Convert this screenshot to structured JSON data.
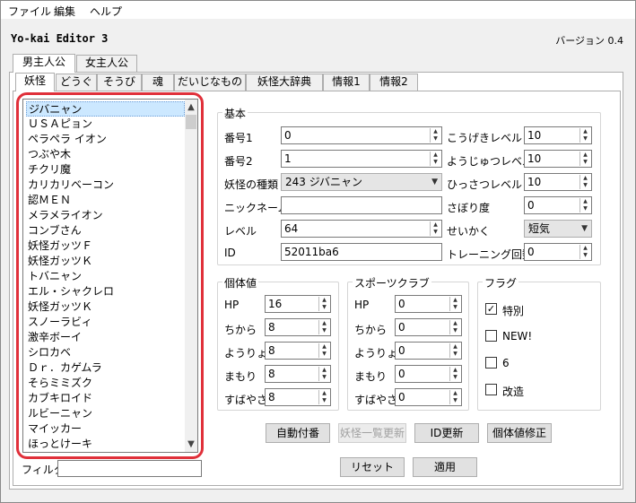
{
  "menubar": {
    "items": [
      "ファイル",
      "編集",
      "ヘルプ"
    ]
  },
  "app": {
    "title": "Yo-kai Editor 3",
    "version": "バージョン 0.4"
  },
  "player_tabs": [
    "男主人公",
    "女主人公"
  ],
  "main_tabs": [
    "妖怪",
    "どうぐ",
    "そうび",
    "魂",
    "だいじなもの",
    "妖怪大辞典",
    "情報1",
    "情報2"
  ],
  "yokai_list": {
    "items": [
      "ジバニャン",
      "ＵＳＡピョン",
      "ペラペラ イオン",
      "つぶや木",
      "チクリ魔",
      "カリカリベーコン",
      "認ＭＥＮ",
      "メラメライオン",
      "コンブさん",
      "妖怪ガッツＦ",
      "妖怪ガッツＫ",
      "トバニャン",
      "エル・シャクレロ",
      "妖怪ガッツＫ",
      "スノーラビィ",
      "激辛ボーイ",
      "シロカベ",
      "Ｄｒ．カゲムラ",
      "そらミミズク",
      "カブキロイド",
      "ルビーニャン",
      "マイッカー",
      "ほっとけーキ"
    ],
    "selected_index": 0
  },
  "filter": {
    "label": "フィルタ",
    "value": ""
  },
  "basic": {
    "title": "基本",
    "no1_label": "番号1",
    "no1_value": "0",
    "no2_label": "番号2",
    "no2_value": "1",
    "kind_label": "妖怪の種類",
    "kind_value": "243 ジバニャン",
    "nickname_label": "ニックネーム",
    "nickname_value": "",
    "level_label": "レベル",
    "level_value": "64",
    "id_label": "ID",
    "id_value": "52011ba6",
    "attack_label": "こうげきレベル",
    "attack_value": "10",
    "magic_label": "ようじゅつレベル",
    "magic_value": "10",
    "special_label": "ひっさつレベル",
    "special_value": "10",
    "loaf_label": "さぼり度",
    "loaf_value": "0",
    "nature_label": "せいかく",
    "nature_value": "短気",
    "training_label": "トレーニング回数",
    "training_value": "0"
  },
  "iv": {
    "title": "個体値",
    "hp_label": "HP",
    "hp_value": "16",
    "str_label": "ちから",
    "str_value": "8",
    "spr_label": "ようりょく",
    "spr_value": "8",
    "def_label": "まもり",
    "def_value": "8",
    "spd_label": "すばやさ",
    "spd_value": "8"
  },
  "sports": {
    "title": "スポーツクラブ",
    "hp_label": "HP",
    "hp_value": "0",
    "str_label": "ちから",
    "str_value": "0",
    "spr_label": "ようりょく",
    "spr_value": "0",
    "def_label": "まもり",
    "def_value": "0",
    "spd_label": "すばやさ",
    "spd_value": "0"
  },
  "flags": {
    "title": "フラグ",
    "items": [
      {
        "label": "特別",
        "checked": "✓"
      },
      {
        "label": "NEW!",
        "checked": ""
      },
      {
        "label": "6",
        "checked": ""
      },
      {
        "label": "改造",
        "checked": ""
      }
    ]
  },
  "buttons": {
    "auto_number": "自動付番",
    "update_list": "妖怪一覧更新",
    "update_id": "ID更新",
    "fix_iv": "個体値修正",
    "reset": "リセット",
    "apply": "適用"
  },
  "colors": {
    "highlight": "#e0303a",
    "selection": "#cce8ff"
  }
}
